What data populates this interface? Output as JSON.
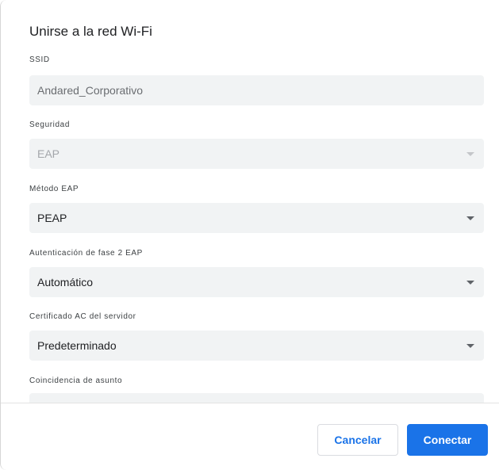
{
  "dialog": {
    "title": "Unirse a la red Wi-Fi"
  },
  "fields": {
    "ssid": {
      "label": "SSID",
      "value": "Andared_Corporativo"
    },
    "security": {
      "label": "Seguridad",
      "value": "EAP"
    },
    "eap_method": {
      "label": "Método EAP",
      "value": "PEAP"
    },
    "phase2_auth": {
      "label": "Autenticación de fase 2 EAP",
      "value": "Automático"
    },
    "server_ca_cert": {
      "label": "Certificado AC del servidor",
      "value": "Predeterminado"
    },
    "subject_match": {
      "label": "Coincidencia de asunto",
      "value": ""
    }
  },
  "buttons": {
    "cancel": "Cancelar",
    "connect": "Conectar"
  },
  "icons": {
    "dropdown": "chevron-down-icon"
  },
  "colors": {
    "accent": "#1a73e8",
    "field_background": "#f1f3f4"
  }
}
